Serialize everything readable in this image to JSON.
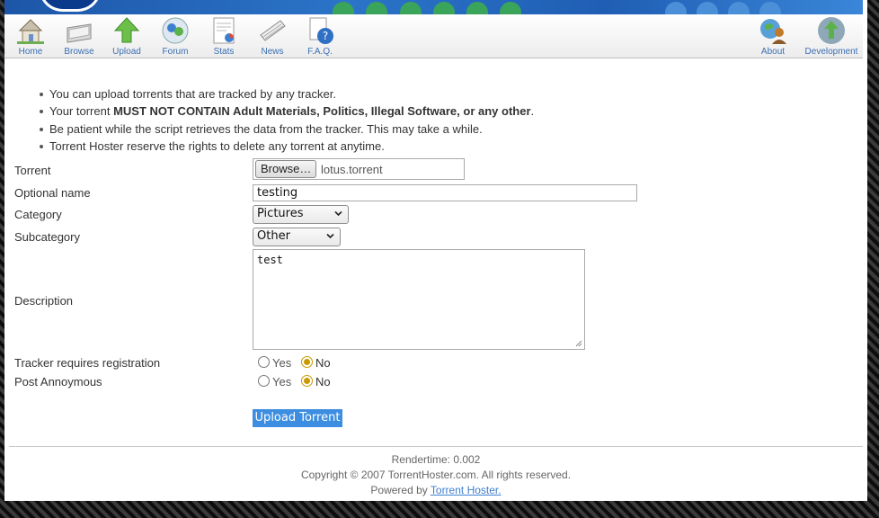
{
  "nav": {
    "left": [
      {
        "label": "Home",
        "icon": "home-icon"
      },
      {
        "label": "Browse",
        "icon": "browse-icon"
      },
      {
        "label": "Upload",
        "icon": "upload-icon"
      },
      {
        "label": "Forum",
        "icon": "forum-icon"
      },
      {
        "label": "Stats",
        "icon": "stats-icon"
      },
      {
        "label": "News",
        "icon": "news-icon"
      },
      {
        "label": "F.A.Q.",
        "icon": "faq-icon"
      }
    ],
    "right": [
      {
        "label": "About",
        "icon": "about-icon"
      },
      {
        "label": "Development",
        "icon": "development-icon"
      }
    ]
  },
  "notes": [
    {
      "text": "You can upload torrents that are tracked by any tracker."
    },
    {
      "prefix": "Your torrent ",
      "bold": "MUST NOT CONTAIN Adult Materials, Politics, Illegal Software, or any other",
      "suffix": "."
    },
    {
      "text": "Be patient while the script retrieves the data from the tracker. This may take a while."
    },
    {
      "text": "Torrent Hoster reserve the rights to delete any torrent at anytime."
    }
  ],
  "form": {
    "torrent_label": "Torrent",
    "browse_label": "Browse…",
    "file_name": "lotus.torrent",
    "optional_name_label": "Optional name",
    "optional_name_value": "testing",
    "category_label": "Category",
    "category_value": "Pictures",
    "subcategory_label": "Subcategory",
    "subcategory_value": "Other",
    "description_label": "Description",
    "description_value": "test",
    "tracker_reg_label": "Tracker requires registration",
    "post_anon_label": "Post Annoymous",
    "yes_label": "Yes",
    "no_label": "No",
    "tracker_reg_selected": "No",
    "post_anon_selected": "No",
    "submit_label": "Upload Torrent"
  },
  "footer": {
    "rendertime": "Rendertime: 0.002",
    "copyright": "Copyright © 2007 TorrentHoster.com. All rights reserved.",
    "powered_prefix": "Powered by ",
    "powered_link": "Torrent Hoster."
  },
  "colors": {
    "accent": "#3d8ee0",
    "link": "#3b6fb3",
    "radio_selected": "#c99a00",
    "banner": "#1f5eb4"
  }
}
